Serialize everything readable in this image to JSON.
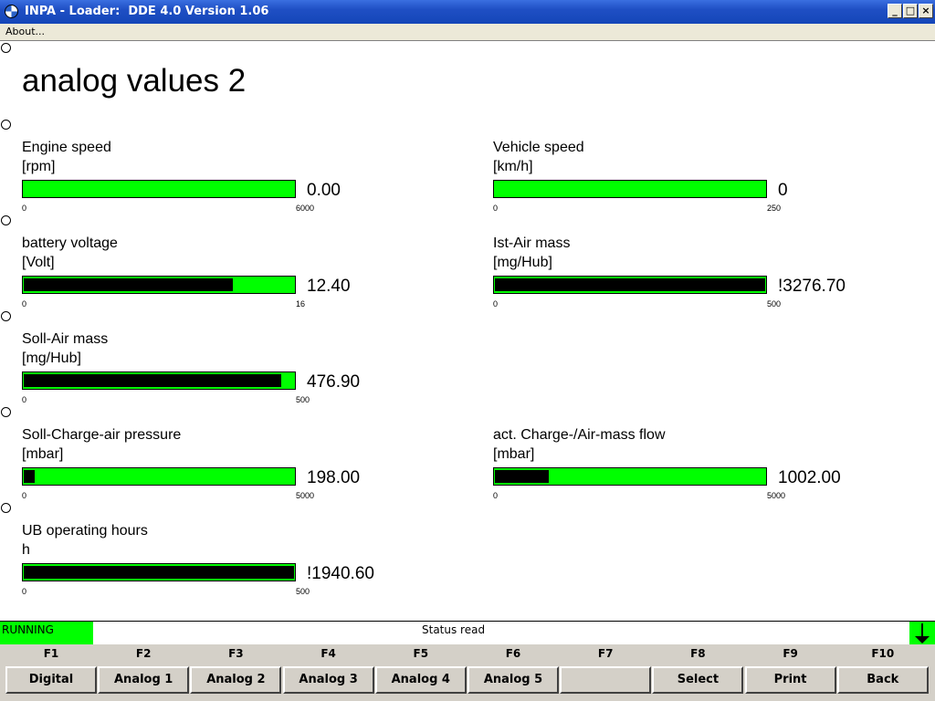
{
  "window": {
    "title": "INPA - Loader:  DDE 4.0 Version 1.06"
  },
  "menu": {
    "about": "About..."
  },
  "page": {
    "title": "analog values 2"
  },
  "gauges": [
    {
      "label": "Engine speed",
      "unit": "[rpm]",
      "value": "0.00",
      "min": "0",
      "max": "6000",
      "fill_fraction": 0.0
    },
    {
      "label": "Vehicle speed",
      "unit": "[km/h]",
      "value": "0",
      "min": "0",
      "max": "250",
      "fill_fraction": 0.0
    },
    {
      "label": "battery voltage",
      "unit": "[Volt]",
      "value": "12.40",
      "min": "0",
      "max": "16",
      "fill_fraction": 0.775
    },
    {
      "label": "Ist-Air mass",
      "unit": "[mg/Hub]",
      "value": "!3276.70",
      "min": "0",
      "max": "500",
      "fill_fraction": 1.0
    },
    {
      "label": "Soll-Air mass",
      "unit": "[mg/Hub]",
      "value": "476.90",
      "min": "0",
      "max": "500",
      "fill_fraction": 0.954
    },
    {
      "label": "Soll-Charge-air pressure",
      "unit": "[mbar]",
      "value": "198.00",
      "min": "0",
      "max": "5000",
      "fill_fraction": 0.0396
    },
    {
      "label": "act. Charge-/Air-mass flow",
      "unit": "[mbar]",
      "value": "1002.00",
      "min": "0",
      "max": "5000",
      "fill_fraction": 0.2004
    },
    {
      "label": "UB operating hours",
      "unit": "h",
      "value": "!1940.60",
      "min": "0",
      "max": "500",
      "fill_fraction": 1.0
    }
  ],
  "status": {
    "state": "RUNNING",
    "message": "Status read"
  },
  "fkeys": [
    {
      "key": "F1",
      "label": "Digital"
    },
    {
      "key": "F2",
      "label": "Analog 1"
    },
    {
      "key": "F3",
      "label": "Analog 2"
    },
    {
      "key": "F4",
      "label": "Analog 3"
    },
    {
      "key": "F5",
      "label": "Analog 4"
    },
    {
      "key": "F6",
      "label": "Analog 5"
    },
    {
      "key": "F7",
      "label": ""
    },
    {
      "key": "F8",
      "label": "Select"
    },
    {
      "key": "F9",
      "label": "Print"
    },
    {
      "key": "F10",
      "label": "Back"
    }
  ],
  "colors": {
    "bar_green": "#00ff00",
    "bar_fill": "#000000",
    "titlebar_blue": "#1f4fc4"
  }
}
